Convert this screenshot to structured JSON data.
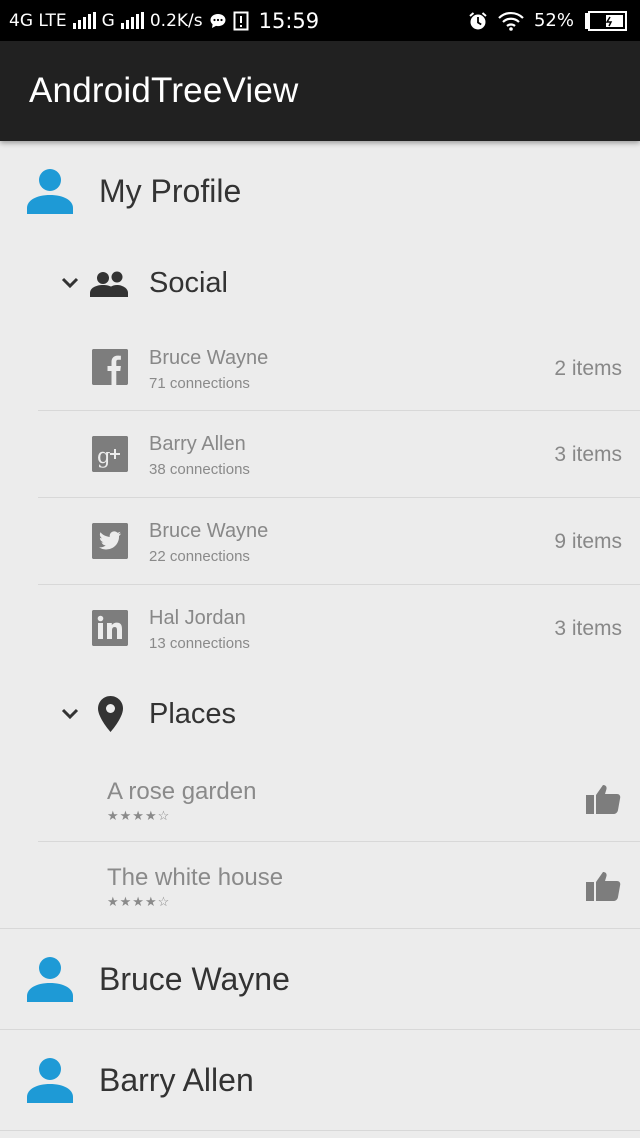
{
  "status_bar": {
    "network_1": "4G LTE",
    "network_2": "G",
    "speed": "0.2K/s",
    "time": "15:59",
    "battery": "52%"
  },
  "app_bar": {
    "title": "AndroidTreeView"
  },
  "tree": {
    "my_profile": "My Profile",
    "social": {
      "label": "Social",
      "items": [
        {
          "icon": "facebook-icon",
          "name": "Bruce Wayne",
          "subtitle": "71 connections",
          "count": "2 items"
        },
        {
          "icon": "google-plus-icon",
          "name": "Barry Allen",
          "subtitle": "38 connections",
          "count": "3 items"
        },
        {
          "icon": "twitter-icon",
          "name": "Bruce Wayne",
          "subtitle": "22 connections",
          "count": "9 items"
        },
        {
          "icon": "linkedin-icon",
          "name": "Hal Jordan",
          "subtitle": "13 connections",
          "count": "3 items"
        }
      ]
    },
    "places": {
      "label": "Places",
      "items": [
        {
          "name": "A rose garden",
          "rating": "★★★★☆"
        },
        {
          "name": "The white house",
          "rating": "★★★★☆"
        }
      ]
    },
    "profiles": [
      "Bruce Wayne",
      "Barry Allen"
    ]
  },
  "colors": {
    "accent": "#1e9ad6",
    "app_bar": "#212121",
    "background": "#ececec",
    "icon_gray": "#7d7d7d"
  }
}
